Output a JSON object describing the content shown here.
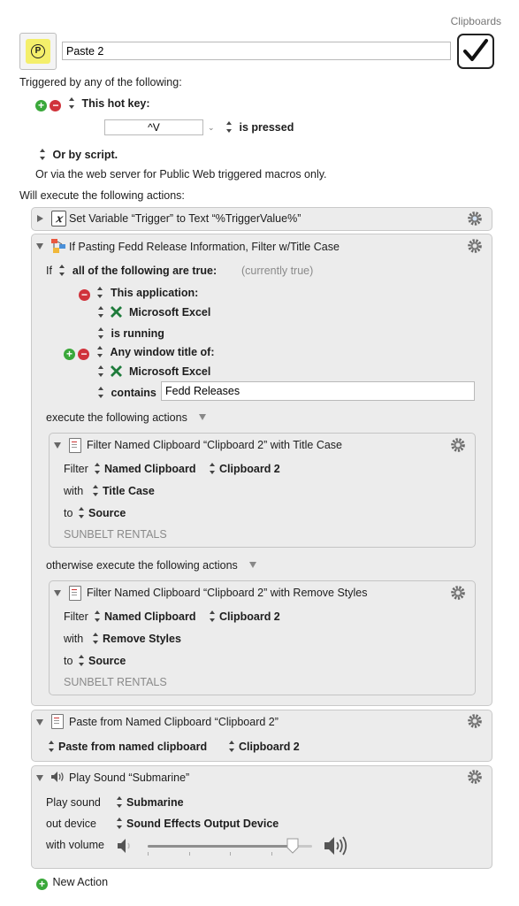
{
  "header": {
    "group_label": "Clipboards",
    "macro_name": "Paste 2",
    "enabled": true
  },
  "triggers": {
    "title": "Triggered by any of the following:",
    "hotkey_label": "This hot key:",
    "hotkey_value": "^V",
    "hotkey_state": "is pressed",
    "script_label": "Or by script.",
    "web_label": "Or via the web server for Public Web triggered macros only."
  },
  "actions_title": "Will execute the following actions:",
  "actions": {
    "set_variable": {
      "title": "Set Variable “Trigger” to Text “%TriggerValue%”"
    },
    "if_block": {
      "title": "If Pasting Fedd Release Information, Filter w/Title Case",
      "if_label": "If",
      "condition_mode": "all of the following are true:",
      "condition_status": "(currently true)",
      "cond1": {
        "label": "This application:",
        "app": "Microsoft Excel",
        "state": "is running"
      },
      "cond2": {
        "label": "Any window title of:",
        "app": "Microsoft Excel",
        "op": "contains",
        "value": "Fedd Releases"
      },
      "then_label": "execute the following actions",
      "else_label": "otherwise execute the following actions",
      "filter1": {
        "title": "Filter Named Clipboard “Clipboard 2” with Title Case",
        "filter_label": "Filter",
        "source_type": "Named Clipboard",
        "clipboard": "Clipboard 2",
        "with_label": "with",
        "filter": "Title Case",
        "to_label": "to",
        "target": "Source",
        "preview": "SUNBELT RENTALS"
      },
      "filter2": {
        "title": "Filter Named Clipboard “Clipboard 2” with Remove Styles",
        "filter_label": "Filter",
        "source_type": "Named Clipboard",
        "clipboard": "Clipboard 2",
        "with_label": "with",
        "filter": "Remove Styles",
        "to_label": "to",
        "target": "Source",
        "preview": "SUNBELT RENTALS"
      }
    },
    "paste": {
      "title": "Paste from Named Clipboard “Clipboard 2”",
      "mode": "Paste from named clipboard",
      "clipboard": "Clipboard 2"
    },
    "sound": {
      "title": "Play Sound “Submarine”",
      "sound_label": "Play sound",
      "sound": "Submarine",
      "device_label": "out device",
      "device": "Sound Effects Output Device",
      "volume_label": "with volume",
      "volume": 0.88
    }
  },
  "new_action_label": "New Action"
}
